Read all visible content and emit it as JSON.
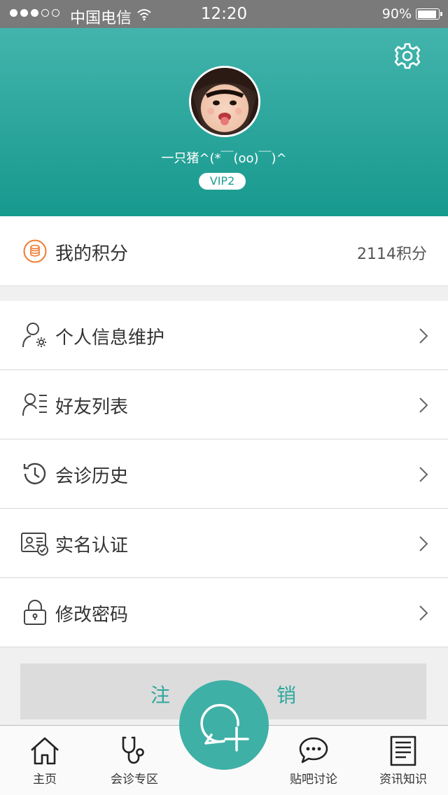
{
  "status_bar": {
    "signal_dots_filled": 3,
    "signal_dots_total": 5,
    "carrier": "中国电信",
    "time": "12:20",
    "battery_percent": "90%",
    "battery_level": 0.9
  },
  "profile": {
    "username": "一只猪^(*￣(oo)￣)^",
    "badge": "VIP2"
  },
  "points": {
    "label": "我的积分",
    "value": "2114积分"
  },
  "menu": [
    {
      "label": "个人信息维护",
      "icon": "user-gear-icon"
    },
    {
      "label": "好友列表",
      "icon": "friend-list-icon"
    },
    {
      "label": "会诊历史",
      "icon": "history-icon"
    },
    {
      "label": "实名认证",
      "icon": "id-card-check-icon"
    },
    {
      "label": "修改密码",
      "icon": "lock-icon"
    }
  ],
  "logout": {
    "char1": "注",
    "char2": "销"
  },
  "tabs": [
    {
      "label": "主页",
      "icon": "home-icon"
    },
    {
      "label": "会诊专区",
      "icon": "stethoscope-icon"
    },
    {
      "label": "贴吧讨论",
      "icon": "chat-bubble-icon"
    },
    {
      "label": "资讯知识",
      "icon": "document-icon"
    }
  ],
  "colors": {
    "header_top": "#43b4ac",
    "header_bottom": "#17998e",
    "accent": "#3fb0a6",
    "points_icon": "#f07a2c"
  }
}
